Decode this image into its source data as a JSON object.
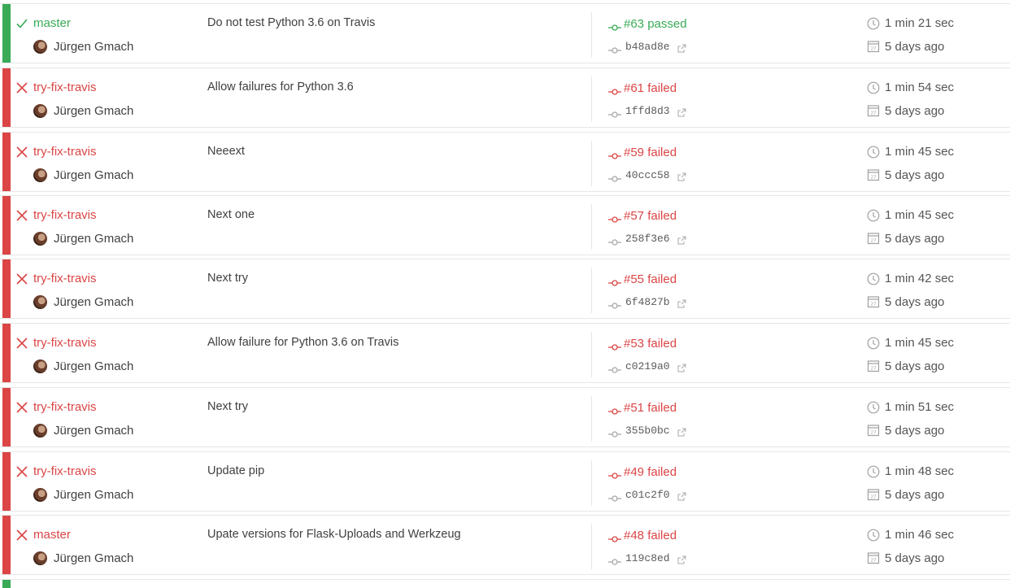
{
  "colors": {
    "passed": "#39aa56",
    "failed": "#db4545"
  },
  "builds": [
    {
      "state": "passed",
      "branch": "master",
      "author": "Jürgen Gmach",
      "message": "Do not test Python 3.6 on Travis",
      "build": "#63 passed",
      "sha": "b48ad8e",
      "duration": "1 min 21 sec",
      "finished": "5 days ago"
    },
    {
      "state": "failed",
      "branch": "try-fix-travis",
      "author": "Jürgen Gmach",
      "message": "Allow failures for Python 3.6",
      "build": "#61 failed",
      "sha": "1ffd8d3",
      "duration": "1 min 54 sec",
      "finished": "5 days ago"
    },
    {
      "state": "failed",
      "branch": "try-fix-travis",
      "author": "Jürgen Gmach",
      "message": "Neeext",
      "build": "#59 failed",
      "sha": "40ccc58",
      "duration": "1 min 45 sec",
      "finished": "5 days ago"
    },
    {
      "state": "failed",
      "branch": "try-fix-travis",
      "author": "Jürgen Gmach",
      "message": "Next one",
      "build": "#57 failed",
      "sha": "258f3e6",
      "duration": "1 min 45 sec",
      "finished": "5 days ago"
    },
    {
      "state": "failed",
      "branch": "try-fix-travis",
      "author": "Jürgen Gmach",
      "message": "Next try",
      "build": "#55 failed",
      "sha": "6f4827b",
      "duration": "1 min 42 sec",
      "finished": "5 days ago"
    },
    {
      "state": "failed",
      "branch": "try-fix-travis",
      "author": "Jürgen Gmach",
      "message": "Allow failure for Python 3.6 on Travis",
      "build": "#53 failed",
      "sha": "c0219a0",
      "duration": "1 min 45 sec",
      "finished": "5 days ago"
    },
    {
      "state": "failed",
      "branch": "try-fix-travis",
      "author": "Jürgen Gmach",
      "message": "Next try",
      "build": "#51 failed",
      "sha": "355b0bc",
      "duration": "1 min 51 sec",
      "finished": "5 days ago"
    },
    {
      "state": "failed",
      "branch": "try-fix-travis",
      "author": "Jürgen Gmach",
      "message": "Update pip",
      "build": "#49 failed",
      "sha": "c01c2f0",
      "duration": "1 min 48 sec",
      "finished": "5 days ago"
    },
    {
      "state": "failed",
      "branch": "master",
      "author": "Jürgen Gmach",
      "message": "Upate versions for Flask-Uploads and Werkzeug",
      "build": "#48 failed",
      "sha": "119c8ed",
      "duration": "1 min 46 sec",
      "finished": "5 days ago"
    }
  ]
}
